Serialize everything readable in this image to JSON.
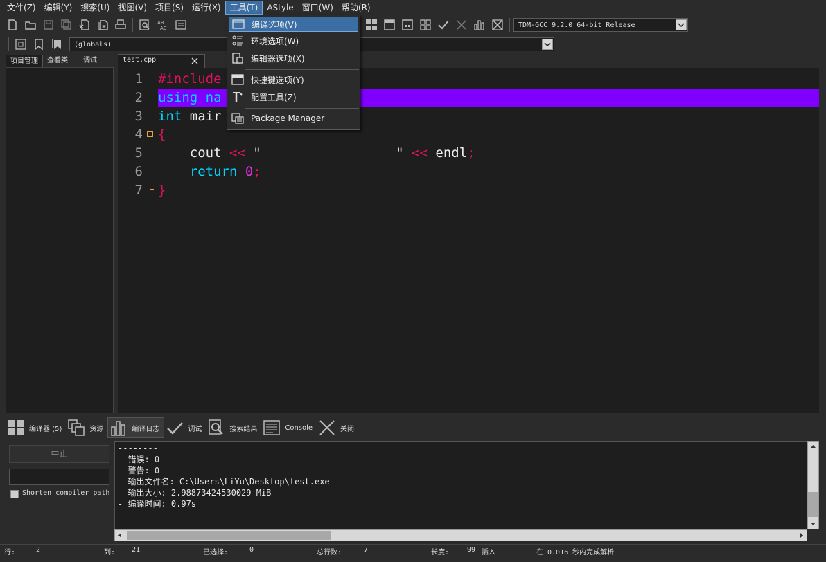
{
  "menubar": {
    "items": [
      "文件(Z)",
      "编辑(Y)",
      "搜索(U)",
      "视图(V)",
      "项目(S)",
      "运行(X)",
      "工具(T)",
      "AStyle",
      "窗口(W)",
      "帮助(R)"
    ],
    "active_index": 6
  },
  "toolbar": {
    "compiler_select": "TDM-GCC 9.2.0 64-bit Release",
    "scope_select": "(globals)"
  },
  "left_panel": {
    "tabs": [
      "项目管理",
      "查看类",
      "调试"
    ],
    "active_tab": 0
  },
  "editor": {
    "file_tab": "test.cpp",
    "line_numbers": [
      "1",
      "2",
      "3",
      "4",
      "5",
      "6",
      "7"
    ],
    "lines": {
      "l1": "#include",
      "l2": "using na",
      "l3_kw": "int",
      "l3_name": " mair",
      "l4": "{",
      "l5_a": "    cout ",
      "l5_op": "<<",
      "l5_str": " \"                 \"",
      "l5_op2": " <<",
      "l5_id": " endl",
      "l5_semi": ";",
      "l6_kw": "    return ",
      "l6_num": "0",
      "l6_semi": ";",
      "l7": "}"
    },
    "colors": {
      "preprocessor": "#e0115f",
      "keyword": "#00d7ff",
      "identifier": "#ececec",
      "operator": "#e0115f",
      "number": "#e033e0",
      "brace": "#e0115f",
      "highlight": "#8000ff"
    }
  },
  "tools_menu": {
    "items": [
      {
        "label": "编译选项(V)",
        "icon": "compiler-options-icon"
      },
      {
        "label": "环境选项(W)",
        "icon": "environment-options-icon"
      },
      {
        "label": "编辑器选项(X)",
        "icon": "editor-options-icon"
      },
      {
        "label": "快捷键选项(Y)",
        "icon": "shortcut-options-icon"
      },
      {
        "label": "配置工具(Z)",
        "icon": "configure-tools-icon"
      },
      {
        "label": "Package Manager",
        "icon": "package-manager-icon"
      }
    ],
    "active_index": 0
  },
  "bottom_tabs": {
    "items": [
      {
        "label": "编译器 (5)",
        "icon": "grid-icon"
      },
      {
        "label": "资源",
        "icon": "resources-icon"
      },
      {
        "label": "编译日志",
        "icon": "chart-icon"
      },
      {
        "label": "调试",
        "icon": "check-icon"
      },
      {
        "label": "搜索结果",
        "icon": "search-results-icon"
      },
      {
        "label": "Console",
        "icon": "console-icon"
      },
      {
        "label": "关闭",
        "icon": "close-icon"
      }
    ],
    "active_index": 2
  },
  "compile_panel": {
    "abort_label": "中止",
    "shorten_label": "Shorten compiler path"
  },
  "log": {
    "lines": [
      "--------",
      "- 错误: 0",
      "- 警告: 0",
      "- 输出文件名: C:\\Users\\LiYu\\Desktop\\test.exe",
      "- 输出大小: 2.98873424530029 MiB",
      "- 编译时间: 0.97s"
    ]
  },
  "statusbar": {
    "row_label": "行:",
    "row_value": "2",
    "col_label": "列:",
    "col_value": "21",
    "sel_label": "已选择:",
    "sel_value": "0",
    "total_label": "总行数:",
    "total_value": "7",
    "len_label": "长度:",
    "len_value": "99",
    "mode": "插入",
    "parse_msg": "在 0.016 秒内完成解析"
  }
}
